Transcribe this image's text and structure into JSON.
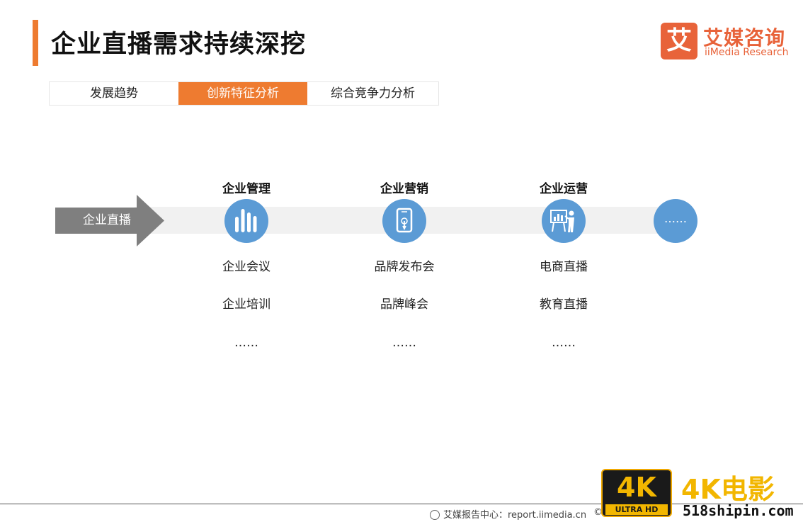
{
  "header": {
    "title": "企业直播需求持续深挖",
    "accent_color": "#ee7b30"
  },
  "logo": {
    "mark": "艾",
    "name_cn": "艾媒咨询",
    "name_en": "iiMedia Research",
    "color": "#e8633a"
  },
  "tabs": [
    {
      "label": "发展趋势",
      "active": false
    },
    {
      "label": "创新特征分析",
      "active": true
    },
    {
      "label": "综合竞争力分析",
      "active": false
    }
  ],
  "diagram": {
    "source_label": "企业直播",
    "columns": [
      {
        "heading": "企业管理",
        "icon": "bar-chart-icon",
        "items": [
          "企业会议",
          "企业培训",
          "……"
        ]
      },
      {
        "heading": "企业营销",
        "icon": "smartphone-touch-icon",
        "items": [
          "品牌发布会",
          "品牌峰会",
          "……"
        ]
      },
      {
        "heading": "企业运营",
        "icon": "presentation-icon",
        "items": [
          "电商直播",
          "教育直播",
          "……"
        ]
      }
    ],
    "more_label": "……",
    "circle_color": "#5b9bd5"
  },
  "footer": {
    "source_text": "艾媒报告中心：report.iimedia.cn",
    "copyright_mark": "©"
  },
  "watermark": {
    "badge_main": "4K",
    "badge_sub": "ULTRA HD",
    "title": "4K电影",
    "url": "518shipin.com"
  }
}
